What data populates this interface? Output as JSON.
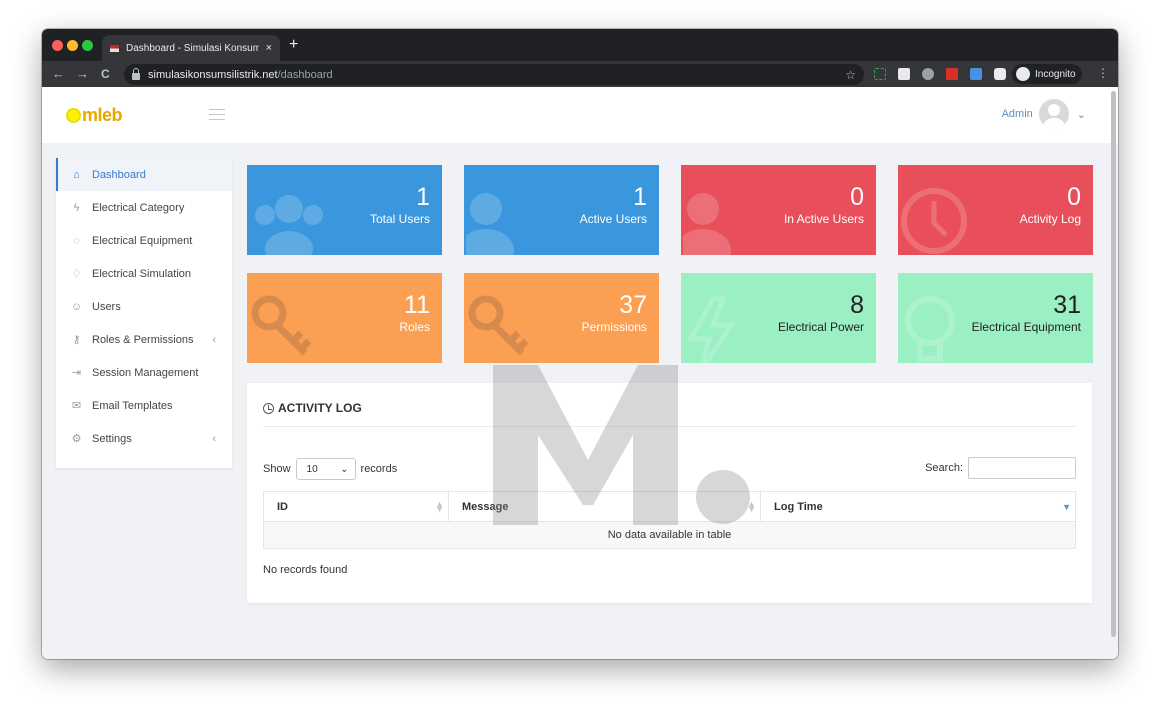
{
  "browser": {
    "tab_title": "Dashboard - Simulasi Konsums",
    "tab_close": "×",
    "new_tab": "+",
    "url_domain": "simulasikonsumsilistrik.net",
    "url_path": "/dashboard",
    "profile_label": "Incognito",
    "nav_back": "←",
    "nav_forward": "→",
    "nav_reload": "C",
    "bookmark_star": "☆",
    "menu_kebab": "⋮"
  },
  "header": {
    "logo_text": "mleb",
    "user_name": "Admin",
    "user_chevron": "⌄"
  },
  "sidebar": {
    "items": [
      {
        "label": "Dashboard",
        "icon": "home-icon",
        "glyph": "⌂",
        "active": true
      },
      {
        "label": "Electrical Category",
        "icon": "lightning-icon",
        "glyph": "ϟ"
      },
      {
        "label": "Electrical Equipment",
        "icon": "bulb-icon",
        "glyph": "◌"
      },
      {
        "label": "Electrical Simulation",
        "icon": "plug-icon",
        "glyph": "♢"
      },
      {
        "label": "Users",
        "icon": "user-icon",
        "glyph": "☺"
      },
      {
        "label": "Roles & Permissions",
        "icon": "key-icon",
        "glyph": "⚷",
        "caret": "‹"
      },
      {
        "label": "Session Management",
        "icon": "login-icon",
        "glyph": "⇥"
      },
      {
        "label": "Email Templates",
        "icon": "envelope-icon",
        "glyph": "✉"
      },
      {
        "label": "Settings",
        "icon": "gear-icon",
        "glyph": "⚙",
        "caret": "‹"
      }
    ]
  },
  "stats": [
    {
      "value": "1",
      "label": "Total Users",
      "color": "#3a97dd",
      "icon": "users-icon"
    },
    {
      "value": "1",
      "label": "Active Users",
      "color": "#3a97dd",
      "icon": "user-icon"
    },
    {
      "value": "0",
      "label": "In Active Users",
      "color": "#e84f5a",
      "icon": "user-icon"
    },
    {
      "value": "0",
      "label": "Activity Log",
      "color": "#e84f5a",
      "icon": "clock-icon"
    },
    {
      "value": "11",
      "label": "Roles",
      "color": "#fb9f52",
      "icon": "key-icon"
    },
    {
      "value": "37",
      "label": "Permissions",
      "color": "#fb9f52",
      "icon": "key-icon"
    },
    {
      "value": "8",
      "label": "Electrical Power",
      "color": "#9af0c2",
      "icon": "lightning-icon"
    },
    {
      "value": "31",
      "label": "Electrical Equipment",
      "color": "#9af0c2",
      "icon": "bulb-icon"
    }
  ],
  "activity_log": {
    "title": "ACTIVITY LOG",
    "show_label": "Show",
    "page_size": "10",
    "records_label": "records",
    "search_label": "Search:",
    "search_value": "",
    "columns": [
      "ID",
      "Message",
      "Log Time"
    ],
    "empty_message": "No data available in table",
    "footer_text": "No records found"
  },
  "colors": {
    "accent": "#3b7ac9",
    "blue_card": "#3a97dd",
    "red_card": "#e84f5a",
    "orange_card": "#fb9f52",
    "green_card": "#9af0c2"
  }
}
